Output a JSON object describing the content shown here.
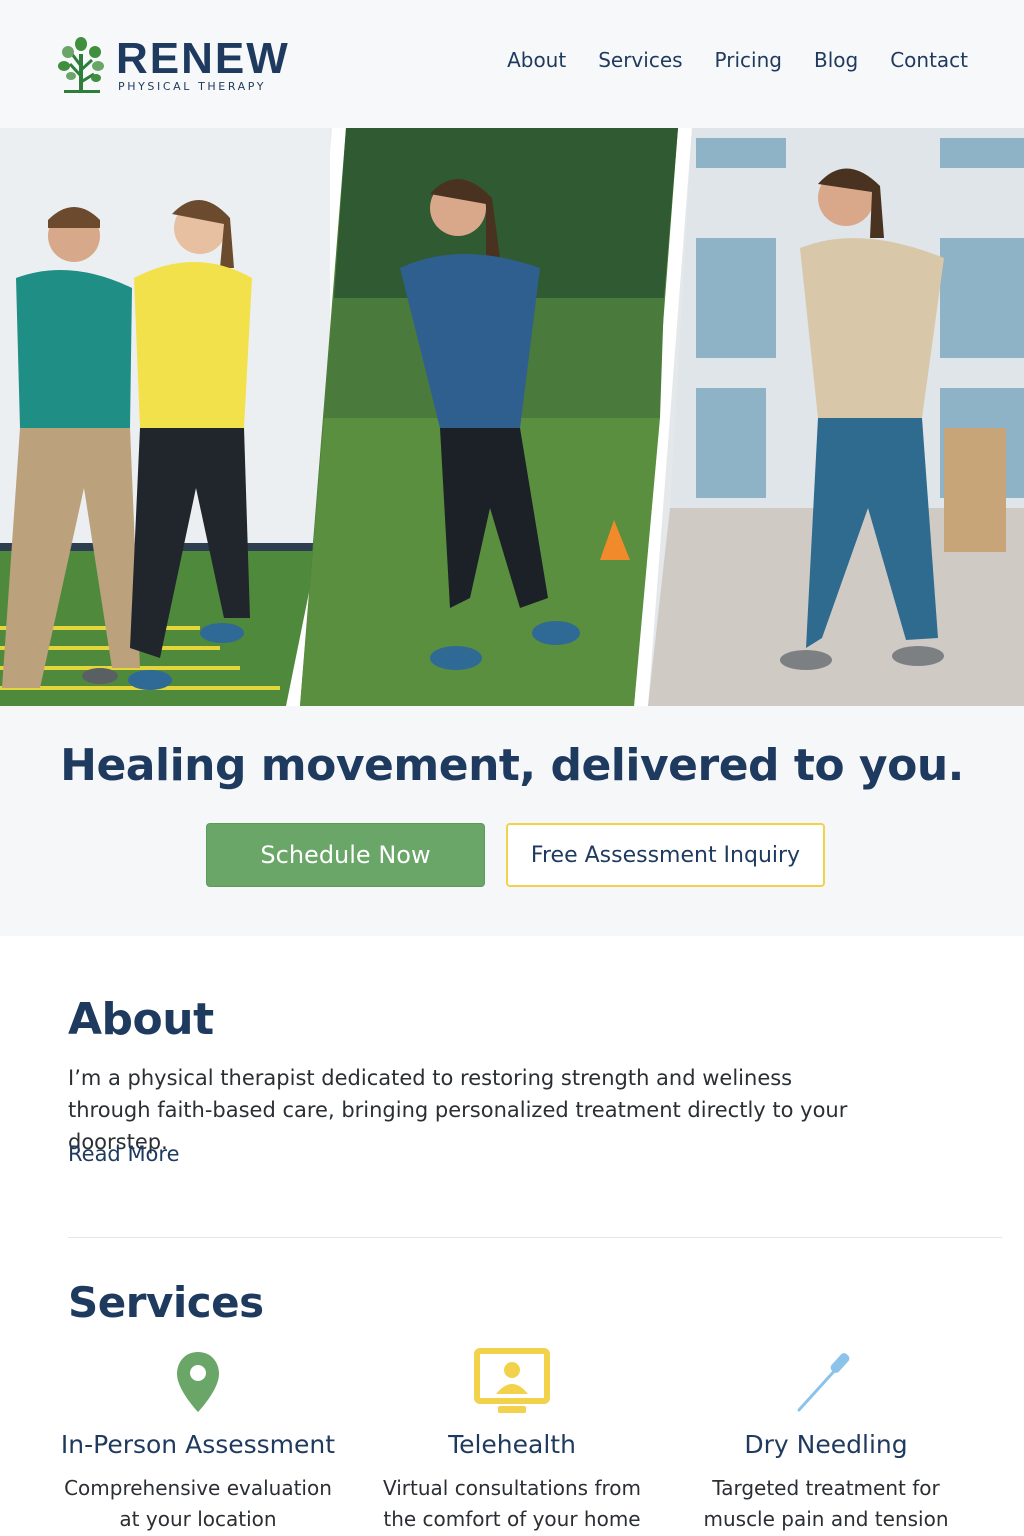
{
  "header": {
    "logo_word": "RENEW",
    "logo_subtitle": "PHYSICAL THERAPY",
    "nav": [
      {
        "label": "About"
      },
      {
        "label": "Services"
      },
      {
        "label": "Pricing"
      },
      {
        "label": "Blog"
      },
      {
        "label": "Contact"
      }
    ]
  },
  "hero": {
    "headline": "Healing movement, delivered to you.",
    "primary_cta": "Schedule Now",
    "secondary_cta": "Free Assessment Inquiry"
  },
  "about": {
    "title": "About",
    "text": "I’m a physical therapist dedicated to restoring strength and weliness through faith-based care, bringing personalized treatment directly to your doorstep.",
    "link": "Read More"
  },
  "services": {
    "title": "Services",
    "items": [
      {
        "icon": "location-pin-icon",
        "title": "In-Person Assessment",
        "desc_line1": "Comprehensive evaluation",
        "desc_line2": "at your location"
      },
      {
        "icon": "monitor-person-icon",
        "title": "Telehealth",
        "desc_line1": "Virtual consultations from",
        "desc_line2": "the comfort of your home"
      },
      {
        "icon": "needle-icon",
        "title": "Dry Needling",
        "desc_line1": "Targeted treatment for",
        "desc_line2": "muscle pain and tension"
      }
    ]
  },
  "colors": {
    "navy": "#1f3a5f",
    "green": "#6aa668",
    "yellow": "#f2d24a",
    "light_blue": "#8cc3ea"
  }
}
